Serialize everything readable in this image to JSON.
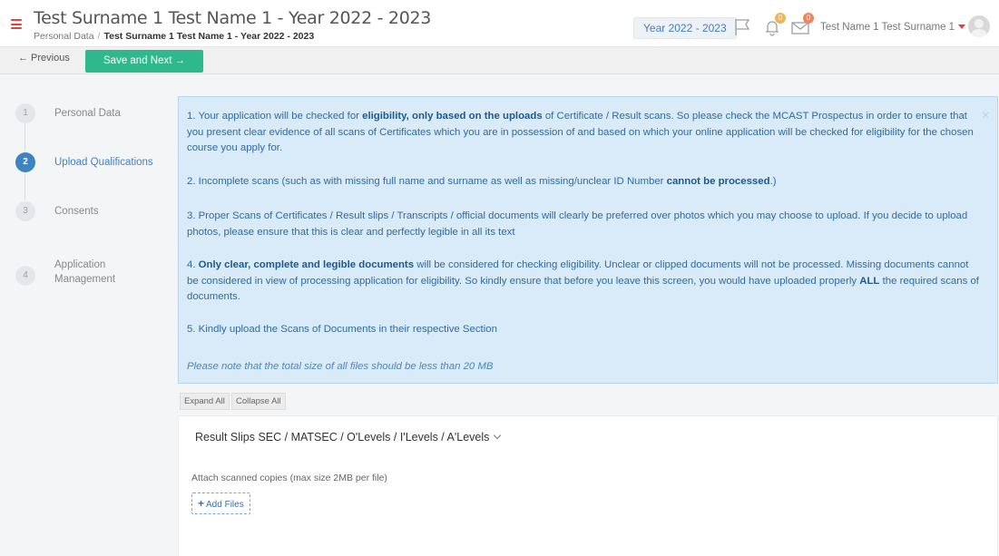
{
  "header": {
    "title": "Test Surname 1 Test Name 1 - Year 2022 - 2023",
    "breadcrumb": [
      "Personal Data",
      "Test Surname 1 Test Name 1 - Year 2022 - 2023"
    ],
    "year_badge": "Year 2022 - 2023",
    "notifications_count": "0",
    "messages_count": "0",
    "user_name": "Test Name 1 Test Surname 1"
  },
  "toolbar": {
    "previous_label": "← Previous",
    "save_next_label": "Save and Next →"
  },
  "steps": [
    {
      "num": "1",
      "label": "Personal Data",
      "active": false
    },
    {
      "num": "2",
      "label": "Upload Qualifications",
      "active": true
    },
    {
      "num": "3",
      "label": "Consents",
      "active": false
    },
    {
      "num": "4",
      "label_line1": "Application",
      "label_line2": "Management",
      "active": false
    }
  ],
  "info": {
    "p1": {
      "a": "1.   Your application will be checked for ",
      "b": "eligibility, only based on the uploads",
      "c": " of Certificate / Result scans.  So please check the MCAST Prospectus in order to ensure that you present clear evidence of all scans of Certificates which you are in possession of and based on which your online application will be checked for eligibility for the chosen course you apply for."
    },
    "p2": {
      "a": "2.   Incomplete scans (such as with missing full name and surname as well as missing/unclear ID Number ",
      "b": "cannot be processed",
      "c": ".)"
    },
    "p3": "3.   Proper Scans of Certificates / Result slips / Transcripts / official documents will clearly be preferred over photos which you may choose to upload.  If you decide to upload photos, please ensure that this is clear and perfectly legible in all its text",
    "p4": {
      "a": "4.   ",
      "b": "Only clear, complete and legible documents",
      "c": " will be considered for checking eligibility.  Unclear or clipped documents will not be processed. Missing documents cannot be considered in view of processing application for eligibility.  So kindly ensure that before you leave this screen, you would have uploaded properly ",
      "d": "ALL",
      "e": " the required scans of documents."
    },
    "p5": "5.   Kindly upload the Scans of Documents in their respective Section",
    "note": "Please note that the total size of all files should be less than 20 MB"
  },
  "controls": {
    "expand_all": "Expand All",
    "collapse_all": "Collapse All"
  },
  "section": {
    "title": "Result Slips SEC / MATSEC / O'Levels / I'Levels / A'Levels",
    "attach_label": "Attach scanned copies (max size 2MB per file)",
    "add_files_label": "Add Files"
  }
}
